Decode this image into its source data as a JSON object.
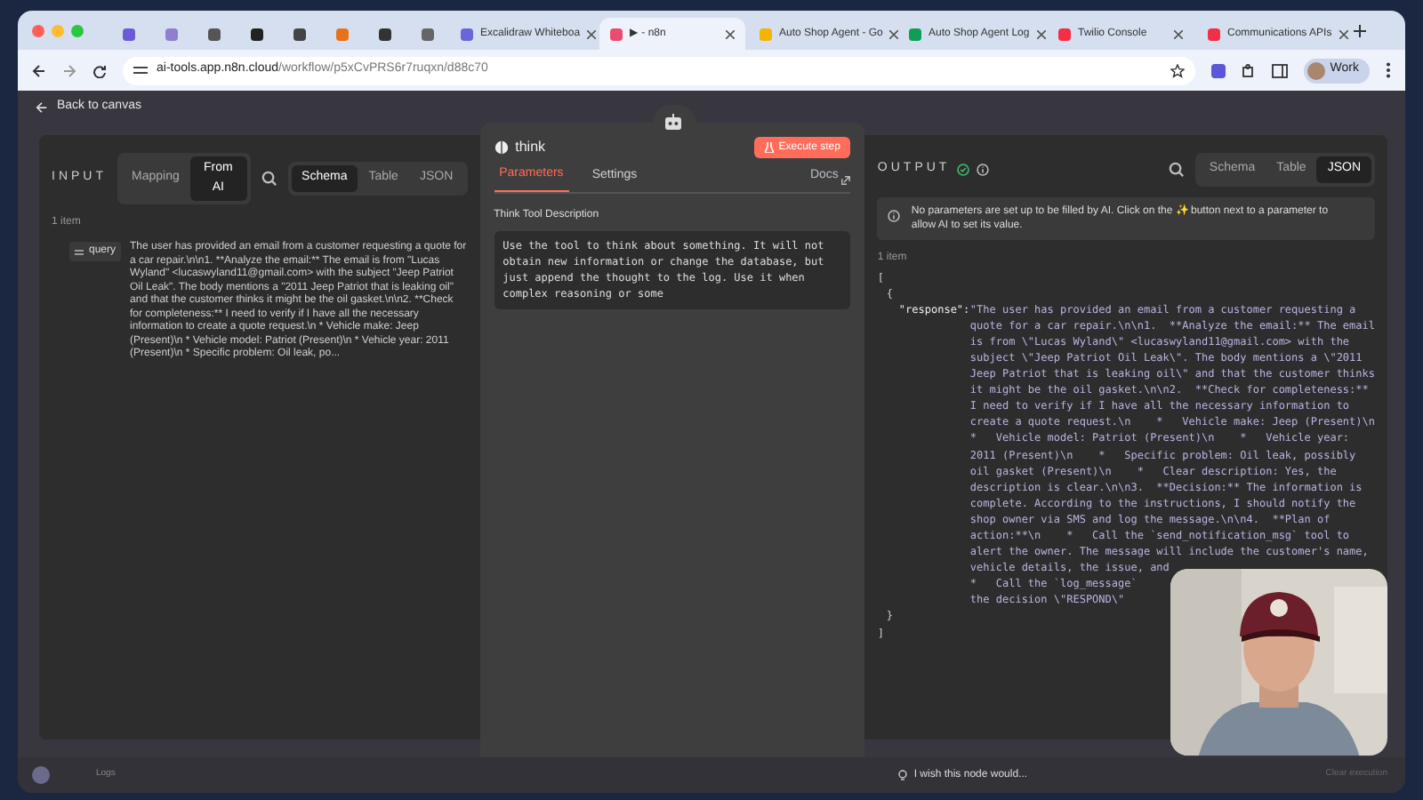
{
  "browser": {
    "tabs": [
      {
        "color": "#6b5bd6",
        "selected": false
      },
      {
        "color": "#8e7fd0",
        "selected": false
      },
      {
        "color": "#555555",
        "selected": false
      },
      {
        "color": "#222222",
        "selected": false
      },
      {
        "color": "#444444",
        "selected": false
      },
      {
        "color": "#e8711a",
        "selected": false
      },
      {
        "color": "#333333",
        "selected": false
      },
      {
        "color": "#666666",
        "selected": false
      },
      {
        "label": "Excalidraw Whiteboa",
        "color": "#6965db",
        "selected": false
      },
      {
        "label": "▶ - n8n",
        "color": "#ea4b71",
        "selected": true
      },
      {
        "label": "Auto Shop Agent - Go",
        "color": "#f4b400",
        "selected": false
      },
      {
        "label": "Auto Shop Agent Log",
        "color": "#0f9d58",
        "selected": false
      },
      {
        "label": "Twilio Console",
        "color": "#f22f46",
        "selected": false
      },
      {
        "label": "Communications APIs",
        "color": "#f22f46",
        "selected": false
      }
    ],
    "url_host": "ai-tools.app.n8n.cloud",
    "url_path": "/workflow/p5xCvPRS6r7ruqxn/d88c70",
    "profile": "Work"
  },
  "back_link": "Back to canvas",
  "input": {
    "title": "INPUT",
    "modes": [
      {
        "label": "Mapping",
        "selected": false
      },
      {
        "label": "From AI",
        "selected": true
      }
    ],
    "views": [
      {
        "label": "Schema",
        "selected": true
      },
      {
        "label": "Table",
        "selected": false
      },
      {
        "label": "JSON",
        "selected": false
      }
    ],
    "count": "1 item",
    "field": "query",
    "value": "The user has provided an email from a customer requesting a quote for a car repair.\\n\\n1. **Analyze the email:** The email is from \"Lucas Wyland\" <lucaswyland11@gmail.com> with the subject \"Jeep Patriot Oil Leak\". The body mentions a \"2011 Jeep Patriot that is leaking oil\" and that the customer thinks it might be the oil gasket.\\n\\n2. **Check for completeness:** I need to verify if I have all the necessary information to create a quote request.\\n * Vehicle make: Jeep (Present)\\n * Vehicle model: Patriot (Present)\\n * Vehicle year: 2011 (Present)\\n * Specific problem: Oil leak, po..."
  },
  "node": {
    "name": "think",
    "execute": "Execute step",
    "tabs": [
      {
        "label": "Parameters",
        "selected": true
      },
      {
        "label": "Settings",
        "selected": false
      }
    ],
    "docs": "Docs",
    "param_label": "Think Tool Description",
    "param_value": "Use the tool to think about something. It will not obtain new information or change the database, but just append the thought to the log. Use it when complex reasoning or some"
  },
  "output": {
    "title": "OUTPUT",
    "views": [
      {
        "label": "Schema",
        "selected": false
      },
      {
        "label": "Table",
        "selected": false
      },
      {
        "label": "JSON",
        "selected": true
      }
    ],
    "notice": "No parameters are set up to be filled by AI. Click on the ✨ button next to a parameter to allow AI to set its value.",
    "count": "1 item",
    "open_bracket": "[",
    "open_brace": "{",
    "key": "\"response\":",
    "close_brace": "}",
    "close_bracket": "]",
    "lines": [
      "\"The user has provided an email from a customer requesting a",
      "quote for a car repair.\\n\\n1.  **Analyze the email:** The email",
      "is from \\\"Lucas Wyland\\\" <lucaswyland11@gmail.com> with the",
      "subject \\\"Jeep Patriot Oil Leak\\\". The body mentions a \\\"2011",
      "Jeep Patriot that is leaking oil\\\" and that the customer thinks",
      "it might be the oil gasket.\\n\\n2.  **Check for completeness:**",
      "I need to verify if I have all the necessary information to",
      "create a quote request.\\n    *   Vehicle make: Jeep (Present)\\n",
      "*   Vehicle model: Patriot (Present)\\n    *   Vehicle year:",
      "2011 (Present)\\n    *   Specific problem: Oil leak, possibly",
      "oil gasket (Present)\\n    *   Clear description: Yes, the",
      "description is clear.\\n\\n3.  **Decision:** The information is",
      "complete. According to the instructions, I should notify the",
      "shop owner via SMS and log the message.\\n\\n4.  **Plan of",
      "action:**\\n    *   Call the `send_notification_msg` tool to",
      "alert the owner. The message will include the customer's name,",
      "vehicle details, the issue, and",
      "*   Call the `log_message`",
      "the decision \\\"RESPOND\\\""
    ]
  },
  "feedback": "I wish this node would...",
  "logs": "Logs",
  "clear": "Clear execution"
}
